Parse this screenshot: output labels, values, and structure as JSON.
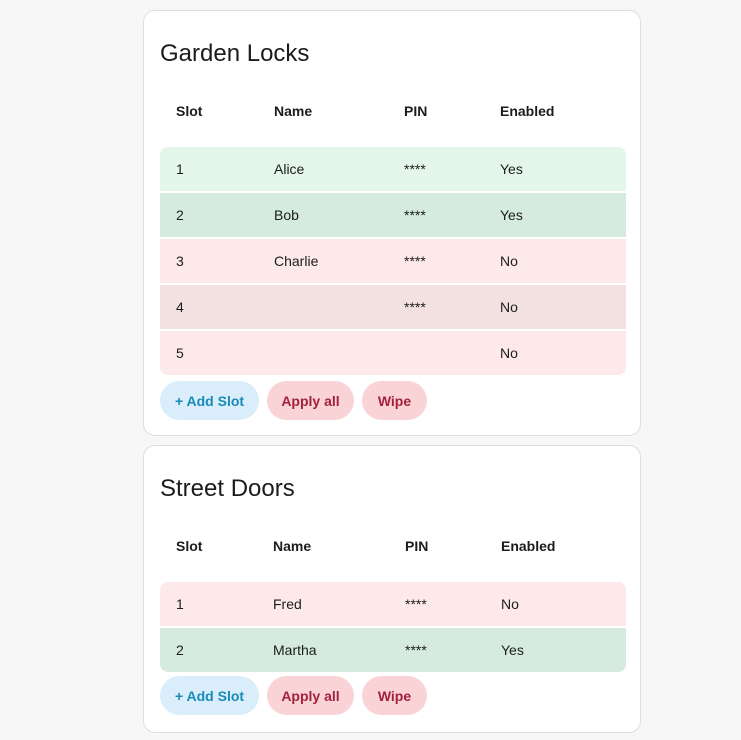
{
  "columns": {
    "slot": "Slot",
    "name": "Name",
    "pin": "PIN",
    "enabled": "Enabled"
  },
  "buttons": {
    "add": "+ Add Slot",
    "apply": "Apply all",
    "wipe": "Wipe"
  },
  "colors": {
    "enabled_row": "#e4f5ea",
    "disabled_row": "#fde9e9",
    "add_button": "#d9eefa",
    "danger_button": "#f9d3d6"
  },
  "locks": [
    {
      "title": "Garden Locks",
      "rows": [
        {
          "slot": "1",
          "name": "Alice",
          "pin": "****",
          "enabled": "Yes"
        },
        {
          "slot": "2",
          "name": "Bob",
          "pin": "****",
          "enabled": "Yes"
        },
        {
          "slot": "3",
          "name": "Charlie",
          "pin": "****",
          "enabled": "No"
        },
        {
          "slot": "4",
          "name": "",
          "pin": "****",
          "enabled": "No"
        },
        {
          "slot": "5",
          "name": "",
          "pin": "",
          "enabled": "No"
        }
      ]
    },
    {
      "title": "Street Doors",
      "rows": [
        {
          "slot": "1",
          "name": "Fred",
          "pin": "****",
          "enabled": "No"
        },
        {
          "slot": "2",
          "name": "Martha",
          "pin": "****",
          "enabled": "Yes"
        }
      ]
    }
  ]
}
